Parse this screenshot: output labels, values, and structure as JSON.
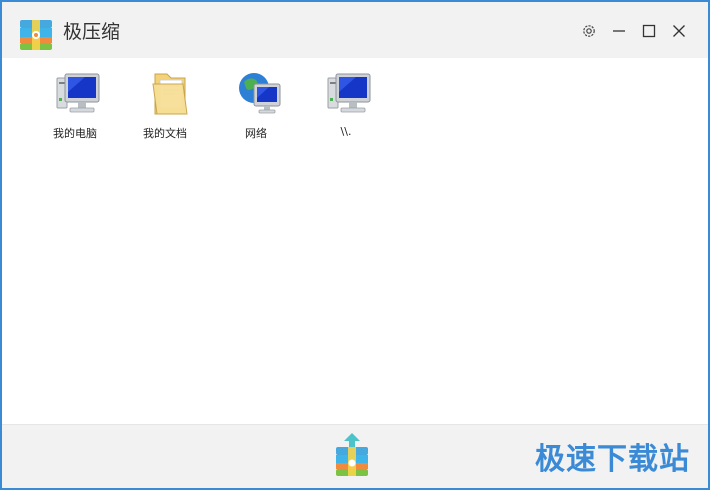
{
  "app": {
    "title": "极压缩",
    "logo_icon": "archive-logo-icon"
  },
  "titlebar": {
    "settings_icon": "gear-icon",
    "minimize_icon": "minimize-icon",
    "maximize_icon": "maximize-icon",
    "close_icon": "close-icon"
  },
  "desktop_items": [
    {
      "label": "我的电脑",
      "icon": "computer-icon"
    },
    {
      "label": "我的文档",
      "icon": "folder-documents-icon"
    },
    {
      "label": "网络",
      "icon": "network-globe-icon"
    },
    {
      "label": "\\\\.",
      "icon": "computer-icon"
    }
  ],
  "footer": {
    "compress_icon": "compress-upload-icon",
    "watermark": "极速下载站"
  },
  "colors": {
    "border": "#3b8ad6",
    "titlebar_bg": "#f2f2f2",
    "footer_bg": "#f2f2f2",
    "watermark": "#3b8ad6"
  }
}
